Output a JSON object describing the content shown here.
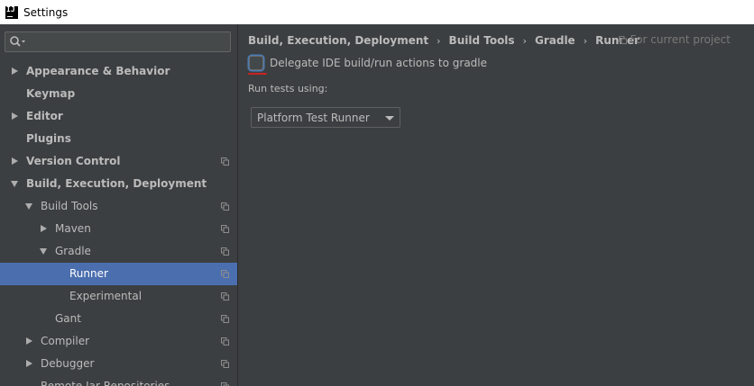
{
  "window": {
    "title": "Settings"
  },
  "search": {
    "placeholder": ""
  },
  "tree": [
    {
      "label": "Appearance & Behavior",
      "level": 0,
      "expand": "right",
      "bold": true,
      "copy": false,
      "selected": false
    },
    {
      "label": "Keymap",
      "level": 0,
      "expand": "none",
      "bold": true,
      "copy": false,
      "selected": false
    },
    {
      "label": "Editor",
      "level": 0,
      "expand": "right",
      "bold": true,
      "copy": false,
      "selected": false
    },
    {
      "label": "Plugins",
      "level": 0,
      "expand": "none",
      "bold": true,
      "copy": false,
      "selected": false
    },
    {
      "label": "Version Control",
      "level": 0,
      "expand": "right",
      "bold": true,
      "copy": true,
      "selected": false
    },
    {
      "label": "Build, Execution, Deployment",
      "level": 0,
      "expand": "down",
      "bold": true,
      "copy": false,
      "selected": false
    },
    {
      "label": "Build Tools",
      "level": 1,
      "expand": "down",
      "bold": false,
      "copy": true,
      "selected": false
    },
    {
      "label": "Maven",
      "level": 2,
      "expand": "right",
      "bold": false,
      "copy": true,
      "selected": false
    },
    {
      "label": "Gradle",
      "level": 2,
      "expand": "down",
      "bold": false,
      "copy": true,
      "selected": false
    },
    {
      "label": "Runner",
      "level": 3,
      "expand": "none",
      "bold": false,
      "copy": true,
      "selected": true
    },
    {
      "label": "Experimental",
      "level": 3,
      "expand": "none",
      "bold": false,
      "copy": true,
      "selected": false
    },
    {
      "label": "Gant",
      "level": 2,
      "expand": "none",
      "bold": false,
      "copy": true,
      "selected": false
    },
    {
      "label": "Compiler",
      "level": 1,
      "expand": "right",
      "bold": false,
      "copy": true,
      "selected": false
    },
    {
      "label": "Debugger",
      "level": 1,
      "expand": "right",
      "bold": false,
      "copy": true,
      "selected": false
    },
    {
      "label": "Remote Jar Repositories",
      "level": 1,
      "expand": "none",
      "bold": false,
      "copy": true,
      "selected": false
    }
  ],
  "breadcrumb": [
    "Build, Execution, Deployment",
    "Build Tools",
    "Gradle",
    "Runner"
  ],
  "breadcrumb_separator": "›",
  "scope_label": "For current project",
  "delegate_checkbox": {
    "label": "Delegate IDE build/run actions to gradle",
    "checked": false
  },
  "run_tests": {
    "label": "Run tests using:",
    "selected": "Platform Test Runner"
  },
  "colors": {
    "selection": "#4b6eaf",
    "background": "#3c3f41",
    "focus": "#4a7bb5",
    "annotation": "#cc2222"
  }
}
